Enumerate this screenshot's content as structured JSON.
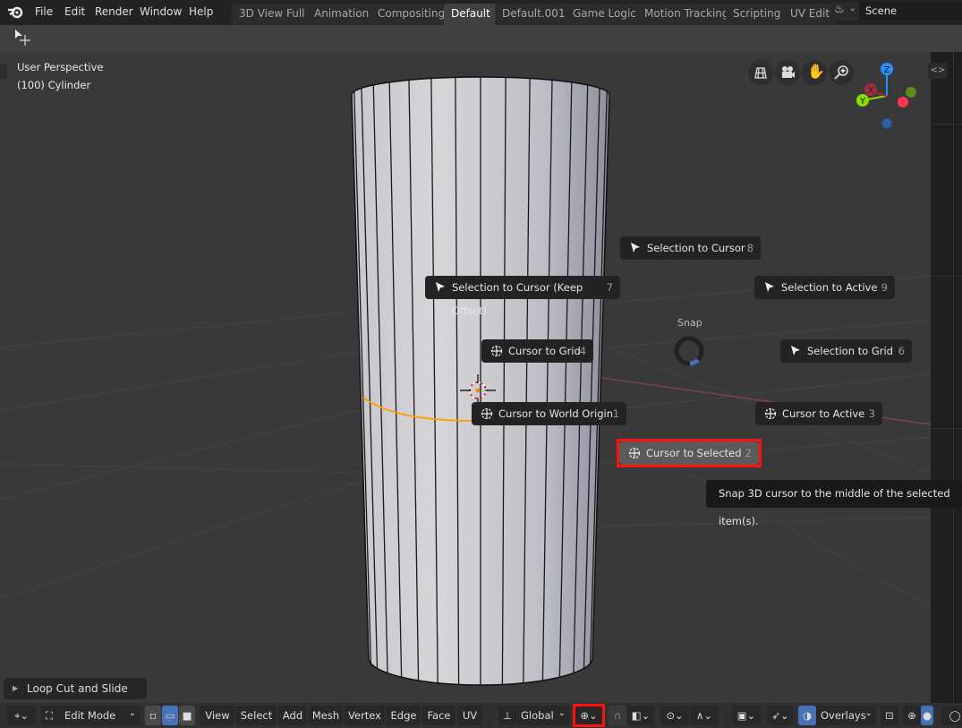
{
  "topbar": {
    "menus": [
      "File",
      "Edit",
      "Render",
      "Window",
      "Help"
    ],
    "workspace_tabs": [
      "3D View Full",
      "Animation",
      "Compositing",
      "Default",
      "Default.001",
      "Game Logic",
      "Motion Tracking",
      "Scripting",
      "UV Edit"
    ],
    "active_tab": "Default",
    "scene_name": "Scene"
  },
  "viewport": {
    "view_name": "User Perspective",
    "object_info": "(100) Cylinder",
    "gizmo_axes": {
      "z": "Z",
      "x": "X",
      "y": "Y"
    },
    "nav_icons": [
      "grid-view-icon",
      "camera-icon",
      "hand-pan-icon",
      "zoom-icon"
    ]
  },
  "pie_menu": {
    "title": "Snap",
    "items": [
      {
        "label": "Selection to Cursor",
        "key": "8",
        "icon": "arrow-cursor-icon"
      },
      {
        "label": "Selection to Cursor (Keep Offset)",
        "key": "7",
        "icon": "arrow-cursor-icon"
      },
      {
        "label": "Selection to Active",
        "key": "9",
        "icon": "arrow-cursor-icon"
      },
      {
        "label": "Cursor to Grid",
        "key": "4",
        "icon": "3d-cursor-icon"
      },
      {
        "label": "Selection to Grid",
        "key": "6",
        "icon": "arrow-cursor-icon"
      },
      {
        "label": "Cursor to World Origin",
        "key": "1",
        "icon": "3d-cursor-icon"
      },
      {
        "label": "Cursor to Active",
        "key": "3",
        "icon": "3d-cursor-icon"
      },
      {
        "label": "Cursor to Selected",
        "key": "2",
        "icon": "3d-cursor-icon",
        "highlighted": true
      }
    ],
    "tooltip": "Snap 3D cursor to the middle of the selected item(s)."
  },
  "last_operator": "Loop Cut and Slide",
  "bottombar": {
    "mode": "Edit Mode",
    "menus": [
      "View",
      "Select",
      "Add",
      "Mesh",
      "Vertex",
      "Edge",
      "Face",
      "UV"
    ],
    "orientation": "Global",
    "overlays": "Overlays"
  },
  "colors": {
    "highlight_border": "#ff1010",
    "accent_blue": "#4772b3",
    "axis_x": "#ff3352",
    "axis_y": "#8bdc00",
    "axis_z": "#2890ff",
    "edge_select": "#ffa000"
  }
}
